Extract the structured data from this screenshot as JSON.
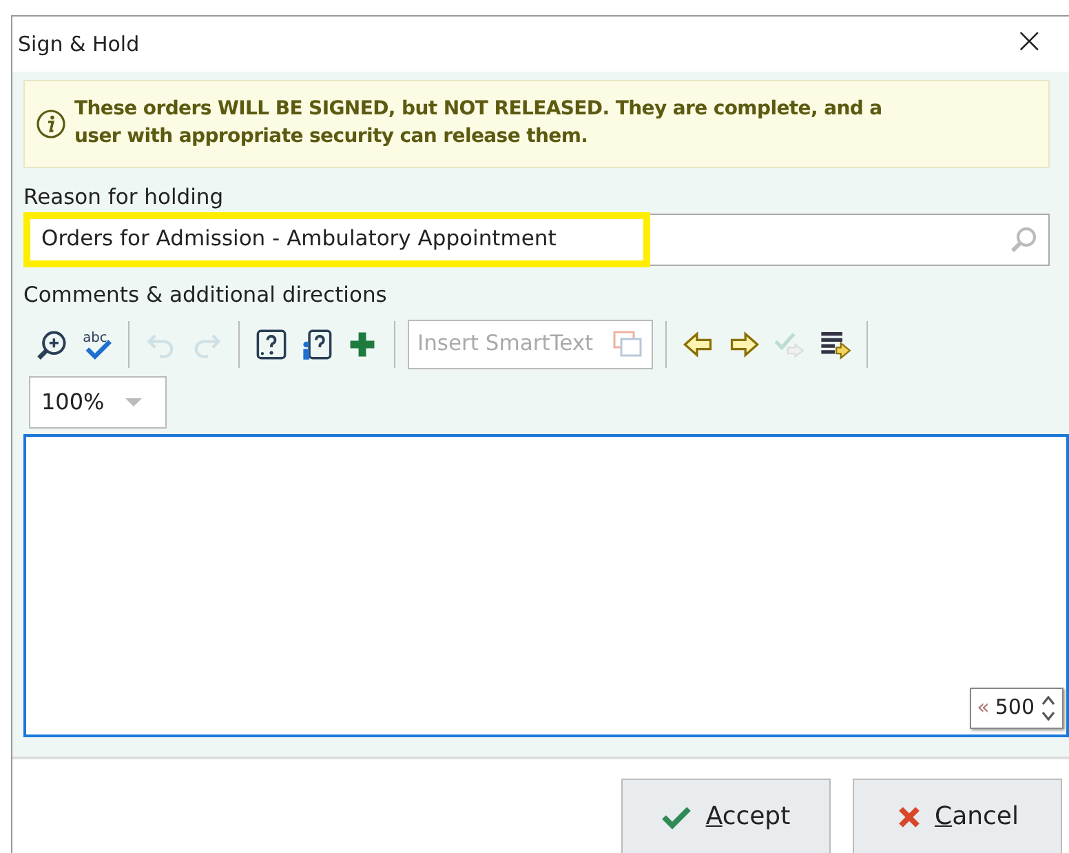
{
  "window": {
    "title": "Sign & Hold",
    "close": "×"
  },
  "banner": {
    "text": "These orders WILL BE SIGNED, but NOT RELEASED. They are complete, and a user with appropriate security can release them."
  },
  "reason": {
    "label": "Reason for holding",
    "value": "Orders for Admission - Ambulatory Appointment",
    "highlighted": true
  },
  "comments": {
    "label": "Comments & additional directions",
    "toolbar": [
      {
        "kind": "zoom",
        "disabled": false
      },
      {
        "kind": "spell",
        "label": "abc",
        "disabled": false
      },
      {
        "kind": "separator"
      },
      {
        "kind": "undo",
        "disabled": true
      },
      {
        "kind": "redo",
        "disabled": true
      },
      {
        "kind": "separator"
      },
      {
        "kind": "help",
        "disabled": false
      },
      {
        "kind": "help-person",
        "disabled": false
      },
      {
        "kind": "add",
        "disabled": false
      },
      {
        "kind": "separator"
      },
      {
        "kind": "smarttext",
        "label": "Insert SmartText",
        "disabled": true
      },
      {
        "kind": "separator"
      },
      {
        "kind": "prev",
        "disabled": false
      },
      {
        "kind": "next",
        "disabled": false
      },
      {
        "kind": "check-next",
        "disabled": true
      },
      {
        "kind": "list-next",
        "disabled": false
      },
      {
        "kind": "separator"
      }
    ],
    "zoom": "100%",
    "counter_prefix": "«",
    "counter": "500"
  },
  "buttons": [
    {
      "kind": "accept",
      "access_key": "A",
      "label_rest": "ccept"
    },
    {
      "kind": "cancel",
      "access_key": "C",
      "label_rest": "ancel"
    }
  ]
}
